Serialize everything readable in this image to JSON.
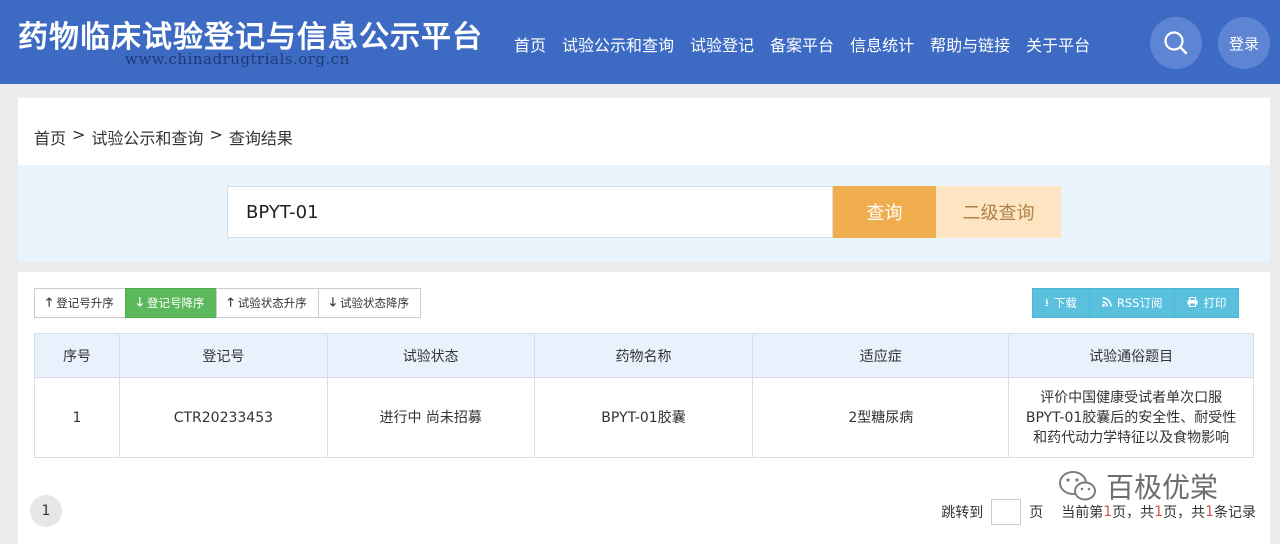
{
  "header": {
    "title": "药物临床试验登记与信息公示平台",
    "url": "www.chinadrugtrials.org.cn",
    "nav": [
      "首页",
      "试验公示和查询",
      "试验登记",
      "备案平台",
      "信息统计",
      "帮助与链接",
      "关于平台"
    ],
    "search_icon": "search-icon",
    "login_label": "登录"
  },
  "breadcrumb": [
    "首页",
    ">",
    "试验公示和查询",
    ">",
    "查询结果"
  ],
  "search": {
    "value": "BPYT-01",
    "query_label": "查询",
    "advanced_label": "二级查询"
  },
  "sort_buttons": [
    {
      "icon": "arrow-up-icon",
      "glyph": "🡑",
      "label": "登记号升序"
    },
    {
      "icon": "arrow-down-icon",
      "glyph": "🡓",
      "label": "登记号降序"
    },
    {
      "icon": "arrow-up-icon",
      "glyph": "🡑",
      "label": "试验状态升序"
    },
    {
      "icon": "arrow-down-icon",
      "glyph": "🡓",
      "label": "试验状态降序"
    }
  ],
  "tools": [
    {
      "icon": "download-icon",
      "glyph": "⭳",
      "label": "下载"
    },
    {
      "icon": "rss-icon",
      "glyph": "⌘",
      "label": "RSS订阅"
    },
    {
      "icon": "print-icon",
      "glyph": "⎙",
      "label": "打印"
    }
  ],
  "table": {
    "headers": [
      "序号",
      "登记号",
      "试验状态",
      "药物名称",
      "适应症",
      "试验通俗题目"
    ],
    "rows": [
      {
        "no": "1",
        "reg_no": "CTR20233453",
        "status": "进行中 尚未招募",
        "drug": "BPYT-01胶囊",
        "indication": "2型糖尿病",
        "title_lines": [
          "评价中国健康受试者单次口服",
          "BPYT-01胶囊后的安全性、耐受性",
          "和药代动力学特征以及食物影响"
        ]
      }
    ]
  },
  "pagination": {
    "current_page": "1",
    "jump_label": "跳转到",
    "page_unit": "页",
    "summary_prefix": "当前第",
    "current": "1",
    "page_sep": "页，共",
    "total_pages": "1",
    "record_sep": "页，共",
    "total_records": "1",
    "record_unit": "条记录"
  },
  "watermark": {
    "text": "百极优棠",
    "icon": "wechat-icon"
  },
  "colors": {
    "header_bg": "#3d6bc4",
    "query_button": "#f0ad4e",
    "advanced_button": "#fde5c3",
    "active_sort": "#5cb85c",
    "tool_button": "#5bc0de",
    "table_header": "#e9f2fc",
    "search_band": "#e8f3fc"
  }
}
